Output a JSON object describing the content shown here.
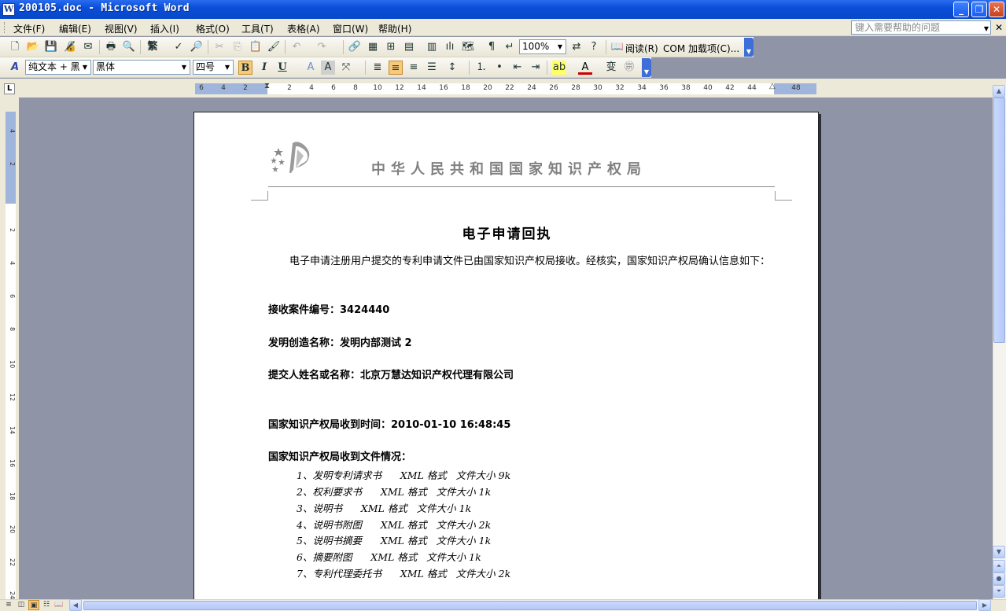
{
  "window": {
    "title": "200105.doc - Microsoft Word",
    "app_icon": "W",
    "controls": {
      "minimize": "_",
      "restore": "❐",
      "close": "✕"
    }
  },
  "menu": {
    "items": [
      "文件(F)",
      "编辑(E)",
      "视图(V)",
      "插入(I)",
      "格式(O)",
      "工具(T)",
      "表格(A)",
      "窗口(W)",
      "帮助(H)"
    ],
    "help_placeholder": "键入需要帮助的问题",
    "close_doc": "✕"
  },
  "toolbar_standard": {
    "zoom": "100%",
    "read_label": "阅读(R)",
    "addins_label": "COM 加载项(C)..."
  },
  "toolbar_format": {
    "style": "纯文本 + 黑",
    "font": "黑体",
    "size": "四号",
    "bold": "B",
    "italic": "I",
    "underline": "U"
  },
  "ruler": {
    "tab_selector": "L",
    "h_numbers": [
      "6",
      "4",
      "2",
      "",
      "2",
      "4",
      "6",
      "8",
      "10",
      "12",
      "14",
      "16",
      "18",
      "20",
      "22",
      "24",
      "26",
      "28",
      "30",
      "32",
      "34",
      "36",
      "38",
      "40",
      "42",
      "44",
      "",
      "48"
    ],
    "v_numbers": [
      "4",
      "2",
      "",
      "2",
      "4",
      "6",
      "8",
      "10",
      "12",
      "14",
      "16",
      "18",
      "20",
      "22",
      "24"
    ]
  },
  "document": {
    "header_org": "中华人民共和国国家知识产权局",
    "title": "电子申请回执",
    "intro": "电子申请注册用户提交的专利申请文件已由国家知识产权局接收。经核实，国家知识产权局确认信息如下：",
    "case_no_label": "接收案件编号：",
    "case_no": "3424440",
    "invention_label": "发明创造名称：",
    "invention": "发明内部测试 2",
    "submitter_label": "提交人姓名或名称：",
    "submitter": "北京万慧达知识产权代理有限公司",
    "received_time_label": "国家知识产权局收到时间：",
    "received_time": "2010-01-10 16:48:45",
    "files_label": "国家知识产权局收到文件情况：",
    "files": [
      "1、发明专利请求书      XML 格式   文件大小 9k",
      "2、权利要求书      XML 格式   文件大小 1k",
      "3、说明书      XML 格式   文件大小 1k",
      "4、说明书附图      XML 格式   文件大小 2k",
      "5、说明书摘要      XML 格式   文件大小 1k",
      "6、摘要附图      XML 格式   文件大小 1k",
      "7、专利代理委托书      XML 格式   文件大小 2k"
    ]
  },
  "colors": {
    "title_bar": "#0a4fd8",
    "workspace": "#8f94a6",
    "header_gray": "#808080"
  }
}
